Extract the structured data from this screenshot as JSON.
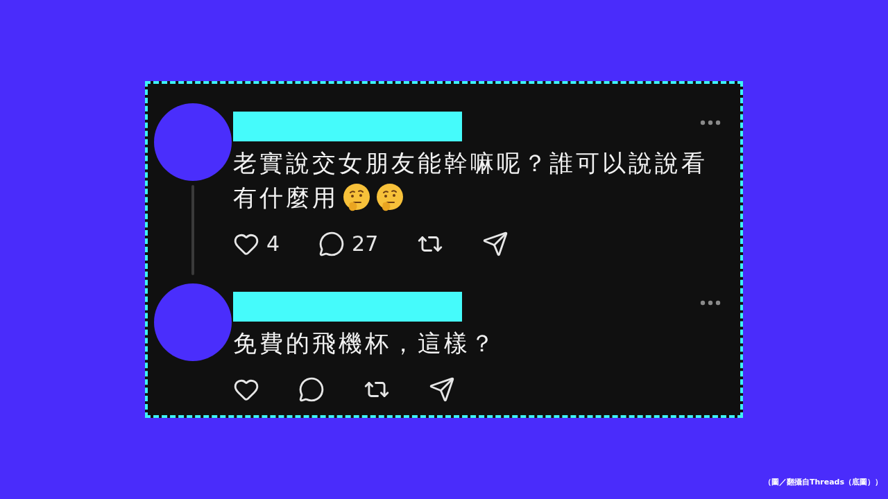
{
  "posts": [
    {
      "thread_line": true,
      "text_lines": [
        "老實說交女朋友能幹嘛呢？誰可以說說看",
        "有什麼用"
      ],
      "reactions": [
        {
          "kind": "thinking"
        },
        {
          "kind": "thinking"
        }
      ],
      "actions": [
        {
          "kind": "like",
          "count": "4"
        },
        {
          "kind": "reply",
          "count": "27"
        },
        {
          "kind": "repost"
        },
        {
          "kind": "share"
        }
      ]
    },
    {
      "thread_line": false,
      "text_lines": [
        "免費的飛機杯，這樣？"
      ],
      "actions": [
        {
          "kind": "like"
        },
        {
          "kind": "reply"
        },
        {
          "kind": "repost"
        },
        {
          "kind": "share"
        }
      ]
    }
  ],
  "caption": "（圖／翻攝自Threads（底圖））"
}
